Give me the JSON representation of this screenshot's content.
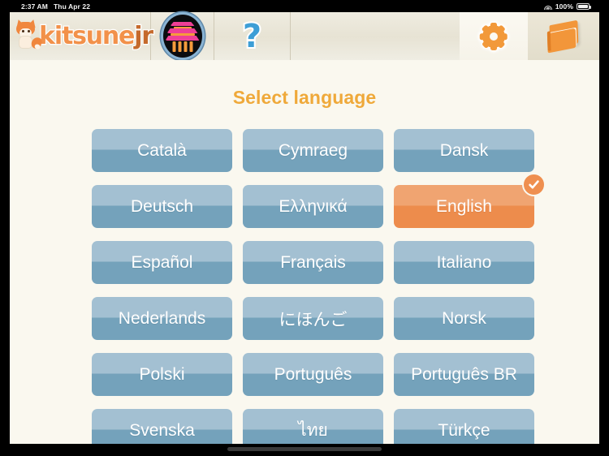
{
  "status_bar": {
    "time": "2:37 AM",
    "date": "Thu Apr 22",
    "wifi_icon": "wifi-icon",
    "battery_percent": "100%",
    "battery_icon": "battery-full-icon"
  },
  "toolbar": {
    "logo": {
      "name": "kitsunejr-logo",
      "text_primary": "kitsune",
      "text_secondary": "jr",
      "mascot_icon": "fox-mascot-icon",
      "color_primary": "#f2914a",
      "color_secondary": "#c56a2c"
    },
    "buttons": [
      {
        "name": "temple-button",
        "icon": "temple-icon",
        "label": ""
      },
      {
        "name": "help-button",
        "icon": "question-mark-icon",
        "label": "?"
      },
      {
        "name": "settings-button",
        "icon": "gear-icon",
        "label": "",
        "active": true
      },
      {
        "name": "library-button",
        "icon": "book-icon",
        "label": ""
      }
    ]
  },
  "main": {
    "title": "Select language",
    "title_color": "#efa93a",
    "selected_language": "English",
    "selected_badge_icon": "check-circle-icon",
    "button_color": "#74a2bb",
    "button_color_selected": "#ed8c4c",
    "languages": [
      {
        "label": "Català",
        "selected": false
      },
      {
        "label": "Cymraeg",
        "selected": false
      },
      {
        "label": "Dansk",
        "selected": false
      },
      {
        "label": "Deutsch",
        "selected": false
      },
      {
        "label": "Ελληνικά",
        "selected": false
      },
      {
        "label": "English",
        "selected": true
      },
      {
        "label": "Español",
        "selected": false
      },
      {
        "label": "Français",
        "selected": false
      },
      {
        "label": "Italiano",
        "selected": false
      },
      {
        "label": "Nederlands",
        "selected": false
      },
      {
        "label": "にほんご",
        "selected": false
      },
      {
        "label": "Norsk",
        "selected": false
      },
      {
        "label": "Polski",
        "selected": false
      },
      {
        "label": "Português",
        "selected": false
      },
      {
        "label": "Português BR",
        "selected": false
      },
      {
        "label": "Svenska",
        "selected": false
      },
      {
        "label": "ไทย",
        "selected": false
      },
      {
        "label": "Türkçe",
        "selected": false
      }
    ]
  },
  "home_indicator": "home-indicator"
}
